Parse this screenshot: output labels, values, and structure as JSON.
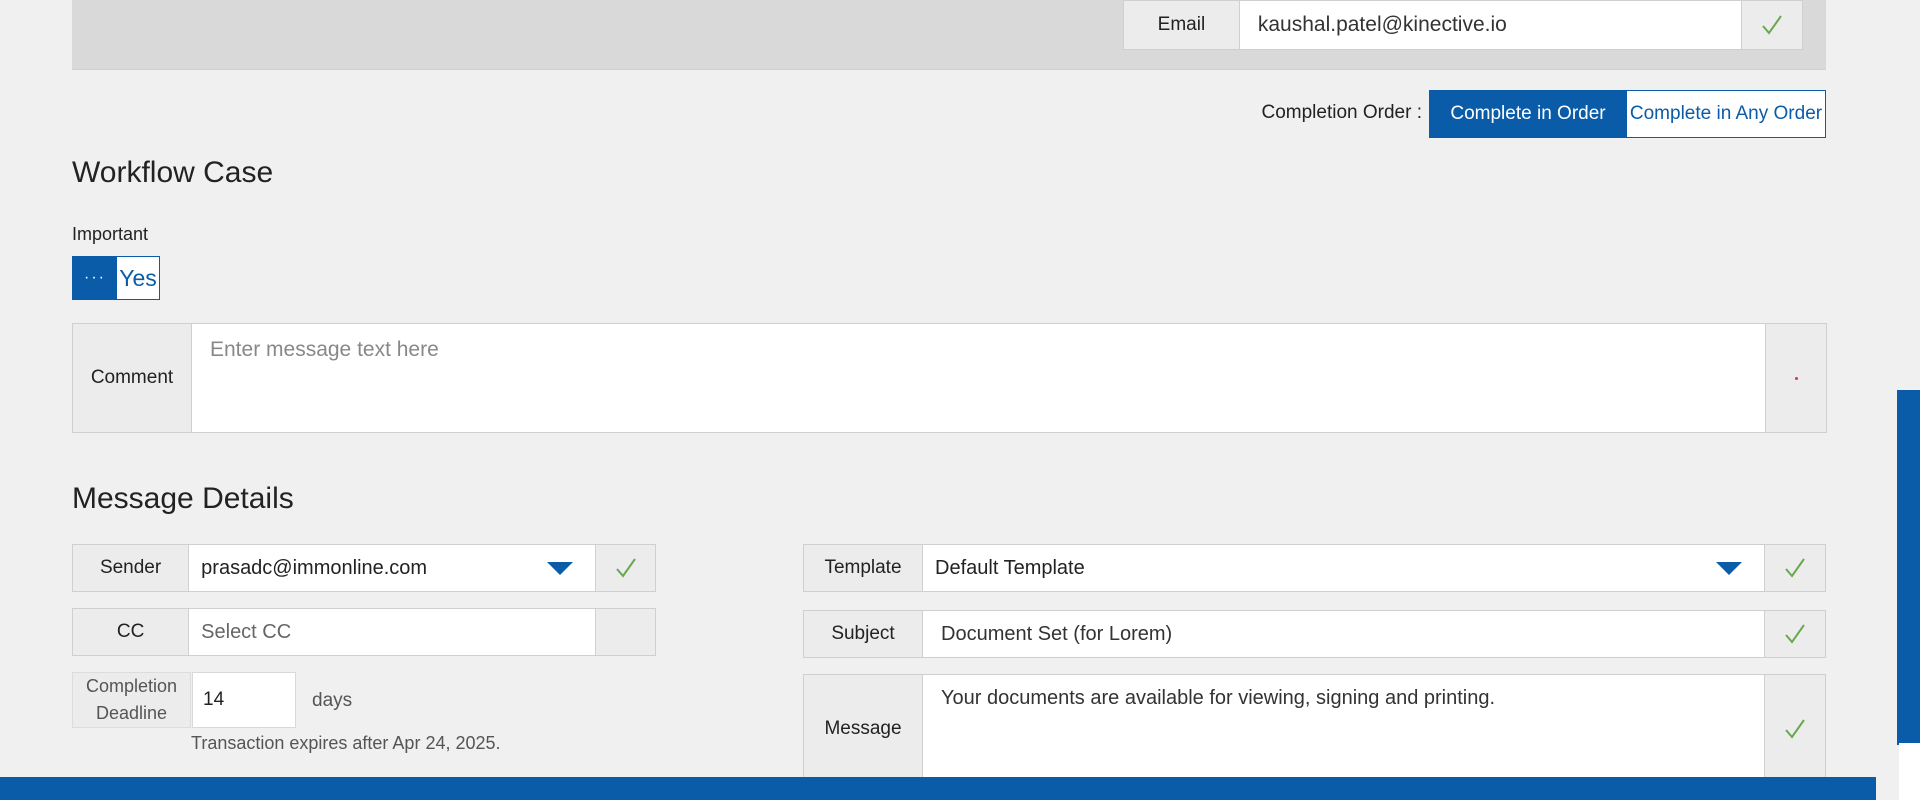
{
  "top": {
    "email_label": "Email",
    "email_value": "kaushal.patel@kinective.io"
  },
  "completion": {
    "label": "Completion Order :",
    "options": [
      "Complete in Order",
      "Complete in Any Order"
    ],
    "selected": "Complete in Order"
  },
  "workflow": {
    "title": "Workflow Case",
    "important_label": "Important",
    "toggle_off": "···",
    "toggle_on": "Yes",
    "comment_label": "Comment",
    "comment_placeholder": "Enter message text here"
  },
  "message": {
    "title": "Message Details",
    "sender_label": "Sender",
    "sender_value": "prasadc@immonline.com",
    "cc_label": "CC",
    "cc_placeholder": "Select CC",
    "deadline_label": "Completion Deadline",
    "deadline_value": "14",
    "deadline_unit": "days",
    "expires_text": "Transaction expires after Apr 24, 2025.",
    "template_label": "Template",
    "template_value": "Default Template",
    "subject_label": "Subject",
    "subject_value": "Document Set (for Lorem)",
    "message_label": "Message",
    "message_value": "Your documents are available for viewing, signing and printing."
  },
  "colors": {
    "accent": "#0b5ca8",
    "check": "#6aa84f",
    "background": "#f0f0f0"
  }
}
